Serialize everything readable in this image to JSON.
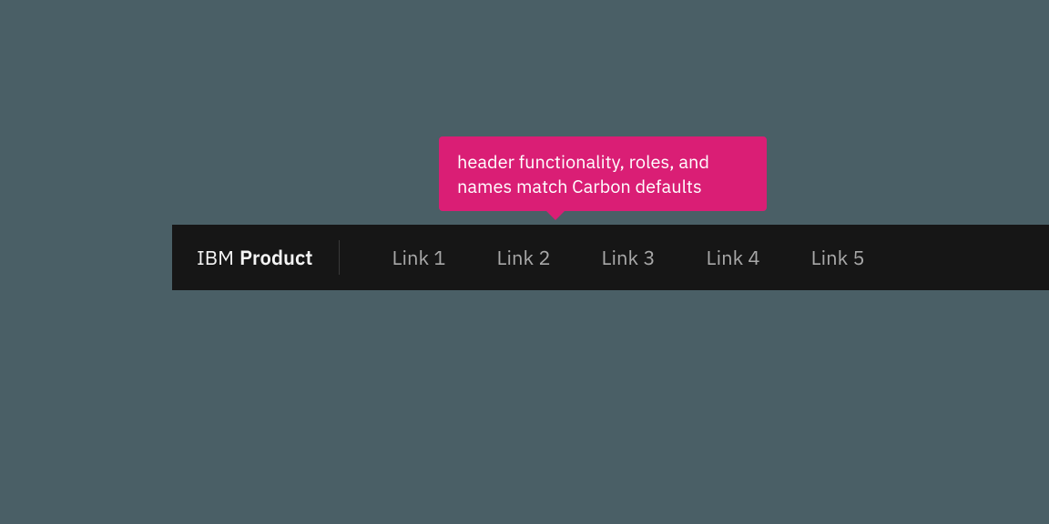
{
  "tooltip": {
    "text": "header functionality, roles, and names match Carbon defaults"
  },
  "header": {
    "brand_prefix": "IBM",
    "brand_name": "Product",
    "links": [
      {
        "label": "Link 1"
      },
      {
        "label": "Link 2"
      },
      {
        "label": "Link 3"
      },
      {
        "label": "Link 4"
      },
      {
        "label": "Link 5"
      }
    ]
  },
  "colors": {
    "background": "#4a5f66",
    "header_bg": "#161616",
    "tooltip_bg": "#da1e75"
  }
}
